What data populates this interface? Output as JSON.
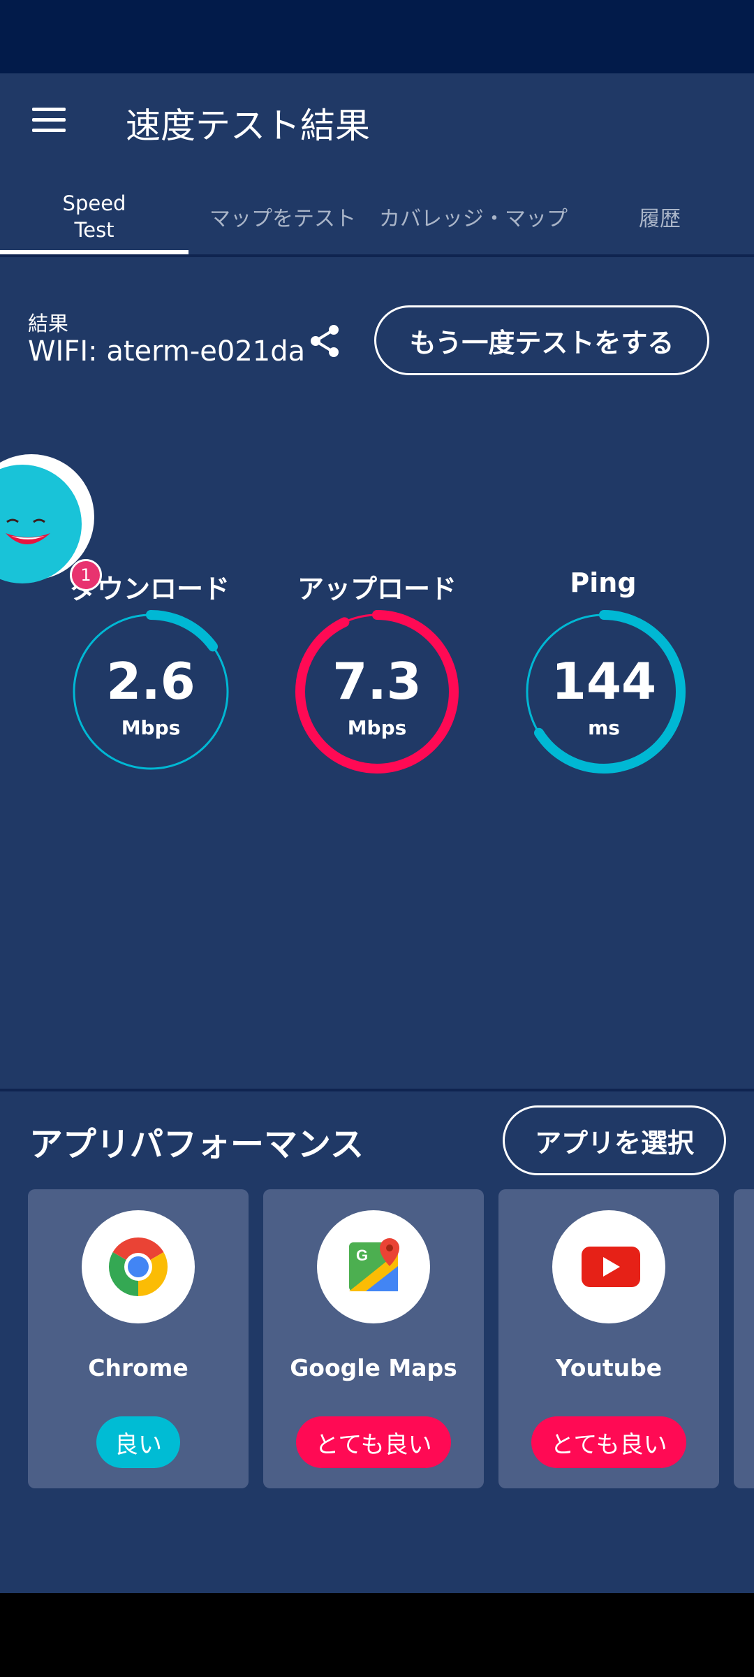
{
  "header": {
    "title": "速度テスト結果",
    "menu_icon": "hamburger-menu-icon"
  },
  "tabs": [
    {
      "label": "Speed\nTest",
      "active": true
    },
    {
      "label": "マップをテスト",
      "active": false
    },
    {
      "label": "カバレッジ・マップ",
      "active": false
    },
    {
      "label": "履歴",
      "active": false
    }
  ],
  "result": {
    "caption": "結果",
    "network": "WIFI: aterm-e021da",
    "share_icon": "share-icon",
    "retest_label": "もう一度テストをする"
  },
  "metrics": {
    "download": {
      "label": "ダウンロード",
      "value": "2.6",
      "unit": "Mbps",
      "color": "#00b8d4",
      "fill": 0.15
    },
    "upload": {
      "label": "アップロード",
      "value": "7.3",
      "unit": "Mbps",
      "color": "#ff0a54",
      "fill": 0.93
    },
    "ping": {
      "label": "Ping",
      "value": "144",
      "unit": "ms",
      "color": "#00b8d4",
      "fill": 0.66
    }
  },
  "notification_badge": "1",
  "apps_section": {
    "title": "アプリパフォーマンス",
    "select_label": "アプリを選択",
    "apps": [
      {
        "name": "Chrome",
        "icon": "chrome-icon",
        "rating": "良い",
        "rating_color": "#00bcd4"
      },
      {
        "name": "Google Maps",
        "icon": "google-maps-icon",
        "rating": "とても良い",
        "rating_color": "#ff0a54"
      },
      {
        "name": "Youtube",
        "icon": "youtube-icon",
        "rating": "とても良い",
        "rating_color": "#ff0a54"
      }
    ]
  },
  "colors": {
    "background": "#203966",
    "status_bar": "#021b4a",
    "card": "#4c5f87"
  }
}
